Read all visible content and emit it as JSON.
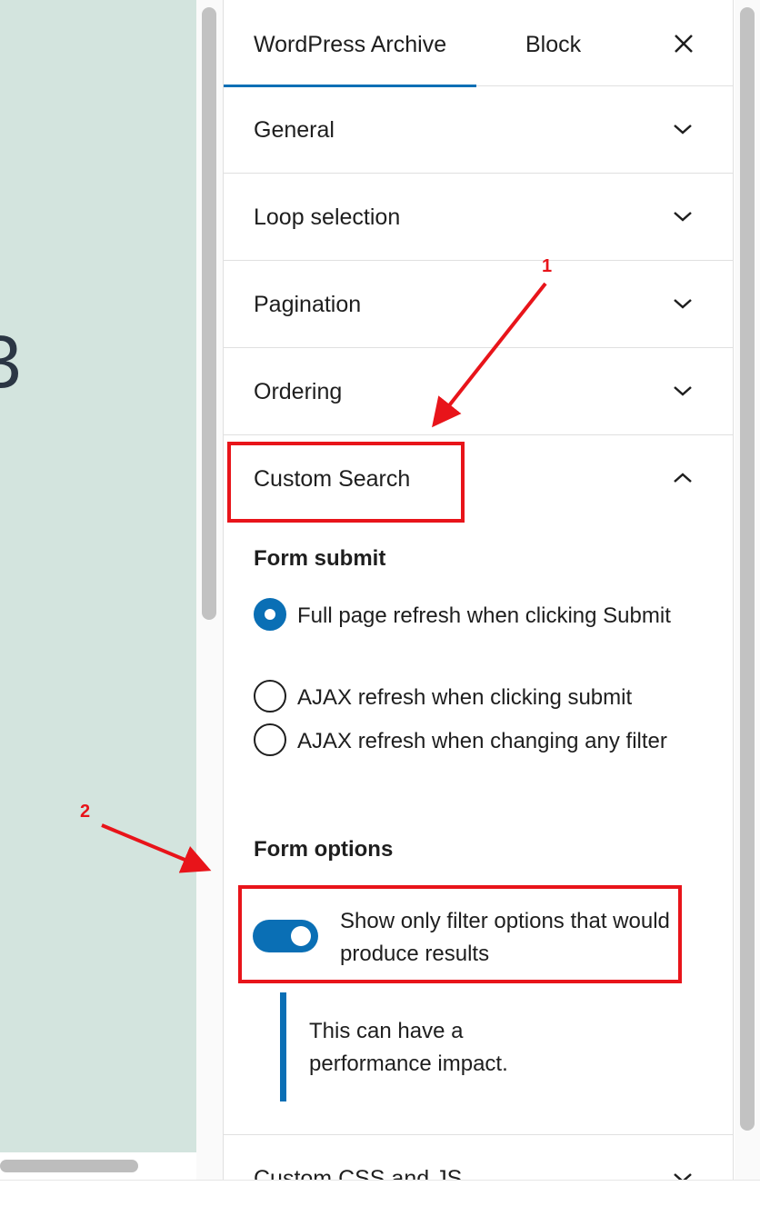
{
  "tabs": [
    {
      "label": "WordPress Archive",
      "active": true
    },
    {
      "label": "Block",
      "active": false
    }
  ],
  "panels": [
    {
      "title": "General"
    },
    {
      "title": "Loop selection"
    },
    {
      "title": "Pagination"
    },
    {
      "title": "Ordering"
    },
    {
      "title": "Custom Search"
    }
  ],
  "custom_search": {
    "form_submit_label": "Form submit",
    "radio_options": [
      {
        "label": "Full page refresh when clicking Submit",
        "checked": true
      },
      {
        "label": "AJAX refresh when clicking submit",
        "checked": false
      },
      {
        "label": "AJAX refresh when changing any filter",
        "checked": false
      }
    ],
    "form_options_label": "Form options",
    "toggle_label": "Show only filter options that would produce results",
    "toggle_on": true,
    "notice": "This can have a performance impact."
  },
  "next_panel": {
    "title": "Custom CSS and JS"
  },
  "annotations": {
    "one": "1",
    "two": "2"
  },
  "colors": {
    "accent": "#0a6fb5",
    "annotation": "#e8141a",
    "canvas": "#d3e4de"
  }
}
